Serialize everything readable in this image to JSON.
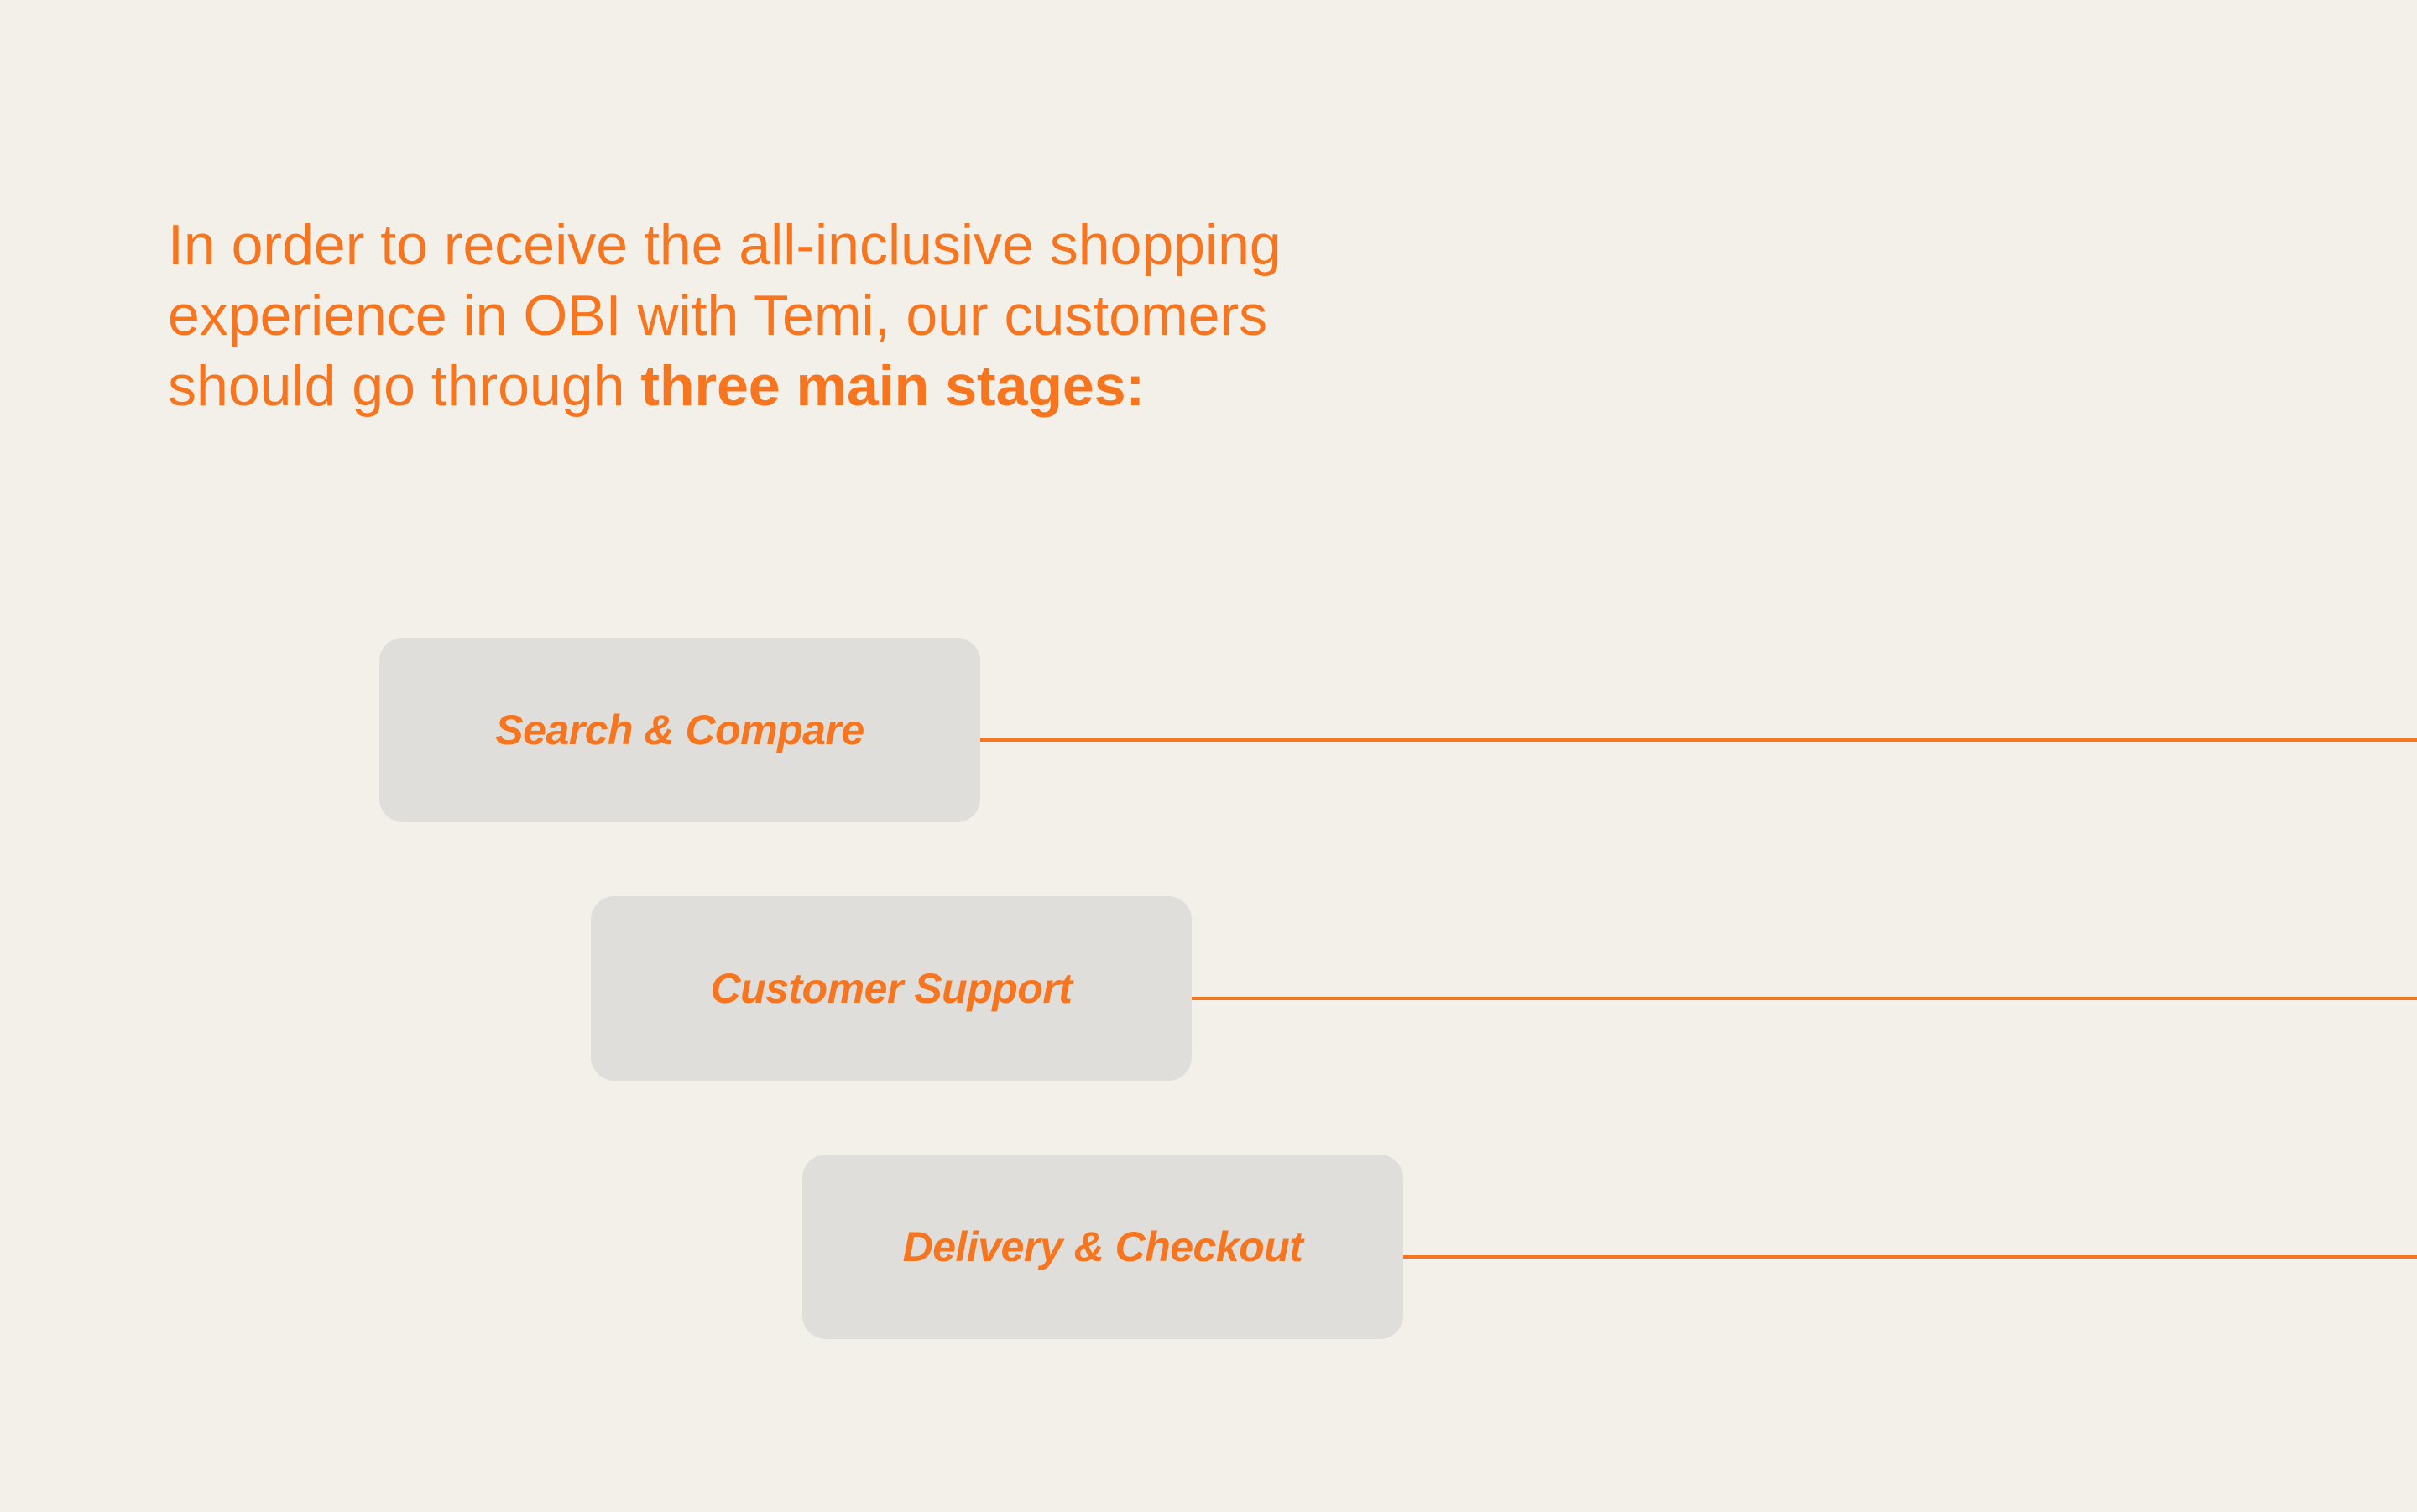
{
  "intro": {
    "line1": "In order to receive the all-inclusive shopping",
    "line2": "experience in OBI with Temi, our customers",
    "line3_prefix": "should go through ",
    "line3_emphasis": "three main stages:"
  },
  "stages": [
    {
      "label": "Search & Compare"
    },
    {
      "label": "Customer Support"
    },
    {
      "label": "Delivery & Checkout"
    }
  ],
  "colors": {
    "accent": "#f7751e",
    "background": "#f3f0ea",
    "box": "#dfdedb"
  }
}
